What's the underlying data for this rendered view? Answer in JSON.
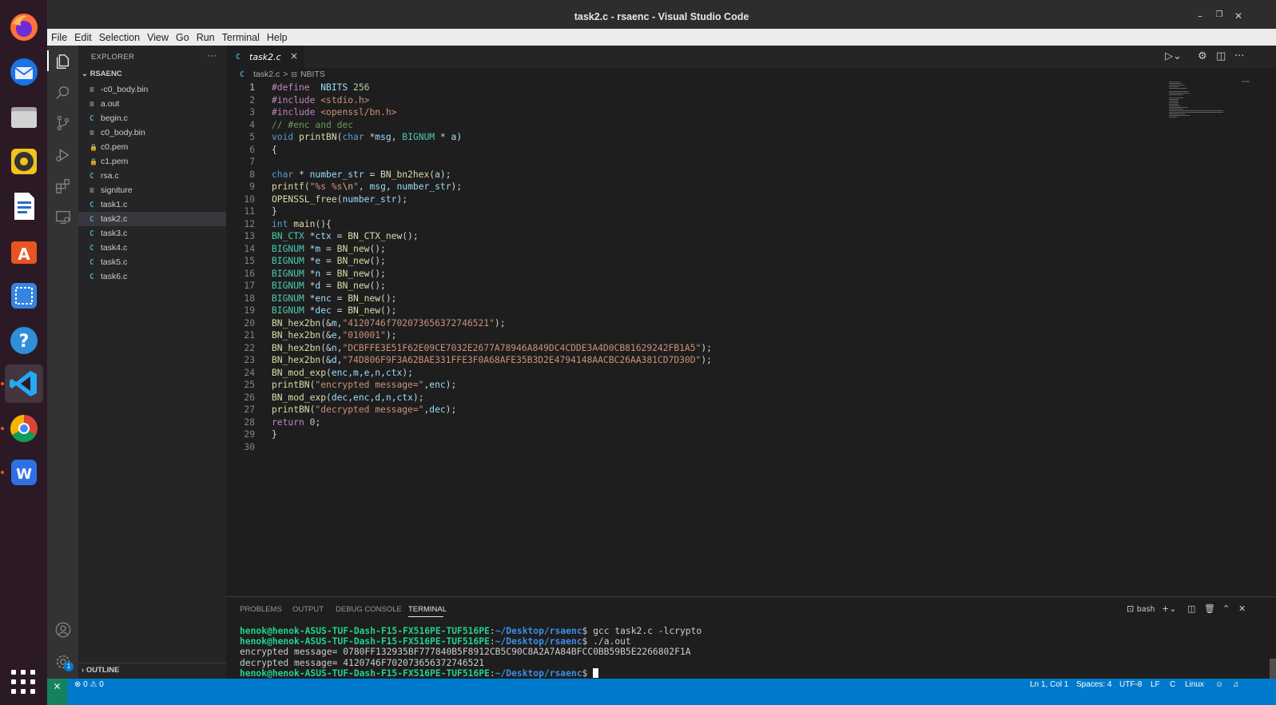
{
  "window": {
    "title": "task2.c - rsaenc - Visual Studio Code"
  },
  "menu": [
    "File",
    "Edit",
    "Selection",
    "View",
    "Go",
    "Run",
    "Terminal",
    "Help"
  ],
  "dock": [
    "firefox-icon",
    "thunderbird-icon",
    "files-icon",
    "rhythmbox-icon",
    "writer-icon",
    "software-icon",
    "screenshot-icon",
    "help-icon",
    "vscode-icon",
    "chrome-icon",
    "wps-icon"
  ],
  "explorer": {
    "header": "EXPLORER",
    "more": "···",
    "folder": "RSAENC",
    "files": [
      {
        "icon": "≡",
        "kind": "txt",
        "name": "-c0_body.bin"
      },
      {
        "icon": "≡",
        "kind": "txt",
        "name": "a.out"
      },
      {
        "icon": "C",
        "kind": "c",
        "name": "begin.c"
      },
      {
        "icon": "≡",
        "kind": "txt",
        "name": "c0_body.bin"
      },
      {
        "icon": "🔒",
        "kind": "lock",
        "name": "c0.pem"
      },
      {
        "icon": "🔒",
        "kind": "lock",
        "name": "c1.pem"
      },
      {
        "icon": "C",
        "kind": "c",
        "name": "rsa.c"
      },
      {
        "icon": "≡",
        "kind": "txt",
        "name": "signiture"
      },
      {
        "icon": "C",
        "kind": "c",
        "name": "task1.c"
      },
      {
        "icon": "C",
        "kind": "c",
        "name": "task2.c",
        "selected": true
      },
      {
        "icon": "C",
        "kind": "c",
        "name": "task3.c"
      },
      {
        "icon": "C",
        "kind": "c",
        "name": "task4.c"
      },
      {
        "icon": "C",
        "kind": "c",
        "name": "task5.c"
      },
      {
        "icon": "C",
        "kind": "c",
        "name": "task6.c"
      }
    ],
    "outline": "OUTLINE"
  },
  "tab": {
    "icon": "C",
    "label": "task2.c",
    "close": "×"
  },
  "breadcrumb": {
    "file": "task2.c",
    "sep": ">",
    "symbol": "NBITS"
  },
  "code": [
    [
      [
        "pp",
        "#define"
      ],
      [
        "",
        "  "
      ],
      [
        "va",
        "NBITS"
      ],
      [
        "",
        " "
      ],
      [
        "nm",
        "256"
      ]
    ],
    [
      [
        "pp",
        "#include"
      ],
      [
        "",
        " "
      ],
      [
        "st",
        "<stdio.h>"
      ]
    ],
    [
      [
        "pp",
        "#include"
      ],
      [
        "",
        " "
      ],
      [
        "st",
        "<openssl/bn.h>"
      ]
    ],
    [
      [
        "cm",
        "// #enc and dec"
      ]
    ],
    [
      [
        "kw",
        "void"
      ],
      [
        "",
        " "
      ],
      [
        "fn",
        "printBN"
      ],
      [
        "",
        "("
      ],
      [
        "kw",
        "char"
      ],
      [
        "",
        " *"
      ],
      [
        "va",
        "msg"
      ],
      [
        "",
        ", "
      ],
      [
        "ty",
        "BIGNUM"
      ],
      [
        "",
        " * "
      ],
      [
        "va",
        "a"
      ],
      [
        "",
        ")"
      ]
    ],
    [
      [
        "",
        "{"
      ]
    ],
    [
      [
        "",
        ""
      ]
    ],
    [
      [
        "kw",
        "char"
      ],
      [
        "",
        " * "
      ],
      [
        "va",
        "number_str"
      ],
      [
        "",
        " = "
      ],
      [
        "fn",
        "BN_bn2hex"
      ],
      [
        "",
        "("
      ],
      [
        "va",
        "a"
      ],
      [
        "",
        ");"
      ]
    ],
    [
      [
        "fn",
        "printf"
      ],
      [
        "",
        "("
      ],
      [
        "st",
        "\"%s %s"
      ],
      [
        "es",
        "\\n"
      ],
      [
        "st",
        "\""
      ],
      [
        "",
        ", "
      ],
      [
        "va",
        "msg"
      ],
      [
        "",
        ", "
      ],
      [
        "va",
        "number_str"
      ],
      [
        "",
        ");"
      ]
    ],
    [
      [
        "fn",
        "OPENSSL_free"
      ],
      [
        "",
        "("
      ],
      [
        "va",
        "number_str"
      ],
      [
        "",
        ");"
      ]
    ],
    [
      [
        "",
        "}"
      ]
    ],
    [
      [
        "kw",
        "int"
      ],
      [
        "",
        " "
      ],
      [
        "fn",
        "main"
      ],
      [
        "",
        "(){"
      ]
    ],
    [
      [
        "ty",
        "BN_CTX"
      ],
      [
        "",
        " *"
      ],
      [
        "va",
        "ctx"
      ],
      [
        "",
        " = "
      ],
      [
        "fn",
        "BN_CTX_new"
      ],
      [
        "",
        "();"
      ]
    ],
    [
      [
        "ty",
        "BIGNUM"
      ],
      [
        "",
        " *"
      ],
      [
        "va",
        "m"
      ],
      [
        "",
        " = "
      ],
      [
        "fn",
        "BN_new"
      ],
      [
        "",
        "();"
      ]
    ],
    [
      [
        "ty",
        "BIGNUM"
      ],
      [
        "",
        " *"
      ],
      [
        "va",
        "e"
      ],
      [
        "",
        " = "
      ],
      [
        "fn",
        "BN_new"
      ],
      [
        "",
        "();"
      ]
    ],
    [
      [
        "ty",
        "BIGNUM"
      ],
      [
        "",
        " *"
      ],
      [
        "va",
        "n"
      ],
      [
        "",
        " = "
      ],
      [
        "fn",
        "BN_new"
      ],
      [
        "",
        "();"
      ]
    ],
    [
      [
        "ty",
        "BIGNUM"
      ],
      [
        "",
        " *"
      ],
      [
        "va",
        "d"
      ],
      [
        "",
        " = "
      ],
      [
        "fn",
        "BN_new"
      ],
      [
        "",
        "();"
      ]
    ],
    [
      [
        "ty",
        "BIGNUM"
      ],
      [
        "",
        " *"
      ],
      [
        "va",
        "enc"
      ],
      [
        "",
        " = "
      ],
      [
        "fn",
        "BN_new"
      ],
      [
        "",
        "();"
      ]
    ],
    [
      [
        "ty",
        "BIGNUM"
      ],
      [
        "",
        " *"
      ],
      [
        "va",
        "dec"
      ],
      [
        "",
        " = "
      ],
      [
        "fn",
        "BN_new"
      ],
      [
        "",
        "();"
      ]
    ],
    [
      [
        "fn",
        "BN_hex2bn"
      ],
      [
        "",
        "(&"
      ],
      [
        "va",
        "m"
      ],
      [
        "",
        ","
      ],
      [
        "st",
        "\"4120746f702073656372746521\""
      ],
      [
        "",
        ");"
      ]
    ],
    [
      [
        "fn",
        "BN_hex2bn"
      ],
      [
        "",
        "(&"
      ],
      [
        "va",
        "e"
      ],
      [
        "",
        ","
      ],
      [
        "st",
        "\"010001\""
      ],
      [
        "",
        ");"
      ]
    ],
    [
      [
        "fn",
        "BN_hex2bn"
      ],
      [
        "",
        "(&"
      ],
      [
        "va",
        "n"
      ],
      [
        "",
        ","
      ],
      [
        "st",
        "\"DCBFFE3E51F62E09CE7032E2677A78946A849DC4CDDE3A4D0CB81629242FB1A5\""
      ],
      [
        "",
        ");"
      ]
    ],
    [
      [
        "fn",
        "BN_hex2bn"
      ],
      [
        "",
        "(&"
      ],
      [
        "va",
        "d"
      ],
      [
        "",
        ","
      ],
      [
        "st",
        "\"74D806F9F3A62BAE331FFE3F0A68AFE35B3D2E4794148AACBC26AA381CD7D30D\""
      ],
      [
        "",
        ");"
      ]
    ],
    [
      [
        "fn",
        "BN_mod_exp"
      ],
      [
        "",
        "("
      ],
      [
        "va",
        "enc"
      ],
      [
        "",
        ","
      ],
      [
        "va",
        "m"
      ],
      [
        "",
        ","
      ],
      [
        "va",
        "e"
      ],
      [
        "",
        ","
      ],
      [
        "va",
        "n"
      ],
      [
        "",
        ","
      ],
      [
        "va",
        "ctx"
      ],
      [
        "",
        ");"
      ]
    ],
    [
      [
        "fn",
        "printBN"
      ],
      [
        "",
        "("
      ],
      [
        "st",
        "\"encrypted message=\""
      ],
      [
        "",
        ","
      ],
      [
        "va",
        "enc"
      ],
      [
        "",
        ");"
      ]
    ],
    [
      [
        "fn",
        "BN_mod_exp"
      ],
      [
        "",
        "("
      ],
      [
        "va",
        "dec"
      ],
      [
        "",
        ","
      ],
      [
        "va",
        "enc"
      ],
      [
        "",
        ","
      ],
      [
        "va",
        "d"
      ],
      [
        "",
        ","
      ],
      [
        "va",
        "n"
      ],
      [
        "",
        ","
      ],
      [
        "va",
        "ctx"
      ],
      [
        "",
        ");"
      ]
    ],
    [
      [
        "fn",
        "printBN"
      ],
      [
        "",
        "("
      ],
      [
        "st",
        "\"decrypted message=\""
      ],
      [
        "",
        ","
      ],
      [
        "va",
        "dec"
      ],
      [
        "",
        ");"
      ]
    ],
    [
      [
        "pp",
        "return"
      ],
      [
        "",
        " "
      ],
      [
        "nm",
        "0"
      ],
      [
        "",
        ";"
      ]
    ],
    [
      [
        "",
        "}"
      ]
    ],
    [
      [
        "",
        ""
      ]
    ]
  ],
  "panel": {
    "tabs": [
      "PROBLEMS",
      "OUTPUT",
      "DEBUG CONSOLE",
      "TERMINAL"
    ],
    "active_tab": "TERMINAL",
    "shell": "bash",
    "terminal": [
      {
        "user": "henok@henok-ASUS-TUF-Dash-F15-FX516PE-TUF516PE",
        "path": "~/Desktop/rsaenc",
        "cmd": "$ gcc task2.c -lcrypto"
      },
      {
        "user": "henok@henok-ASUS-TUF-Dash-F15-FX516PE-TUF516PE",
        "path": "~/Desktop/rsaenc",
        "cmd": "$ ./a.out"
      },
      {
        "text": "encrypted message= 0780FF132935BF777840B5F8912CB5C90C8A2A7A84BFCC0BB59B5E2266802F1A"
      },
      {
        "text": "decrypted message= 4120746F702073656372746521"
      },
      {
        "user": "henok@henok-ASUS-TUF-Dash-F15-FX516PE-TUF516PE",
        "path": "~/Desktop/rsaenc",
        "cmd": "$ ",
        "cursor": true
      }
    ]
  },
  "status": {
    "problems": "⊗ 0 ⚠ 0",
    "position": "Ln 1, Col 1",
    "spaces": "Spaces: 4",
    "encoding": "UTF-8",
    "eol": "LF",
    "language": "C",
    "platform": "Linux"
  },
  "badge": "1",
  "colors": {
    "accent": "#007acc",
    "activity": "#333333",
    "sidebar": "#252526",
    "editor": "#1e1e1e"
  }
}
